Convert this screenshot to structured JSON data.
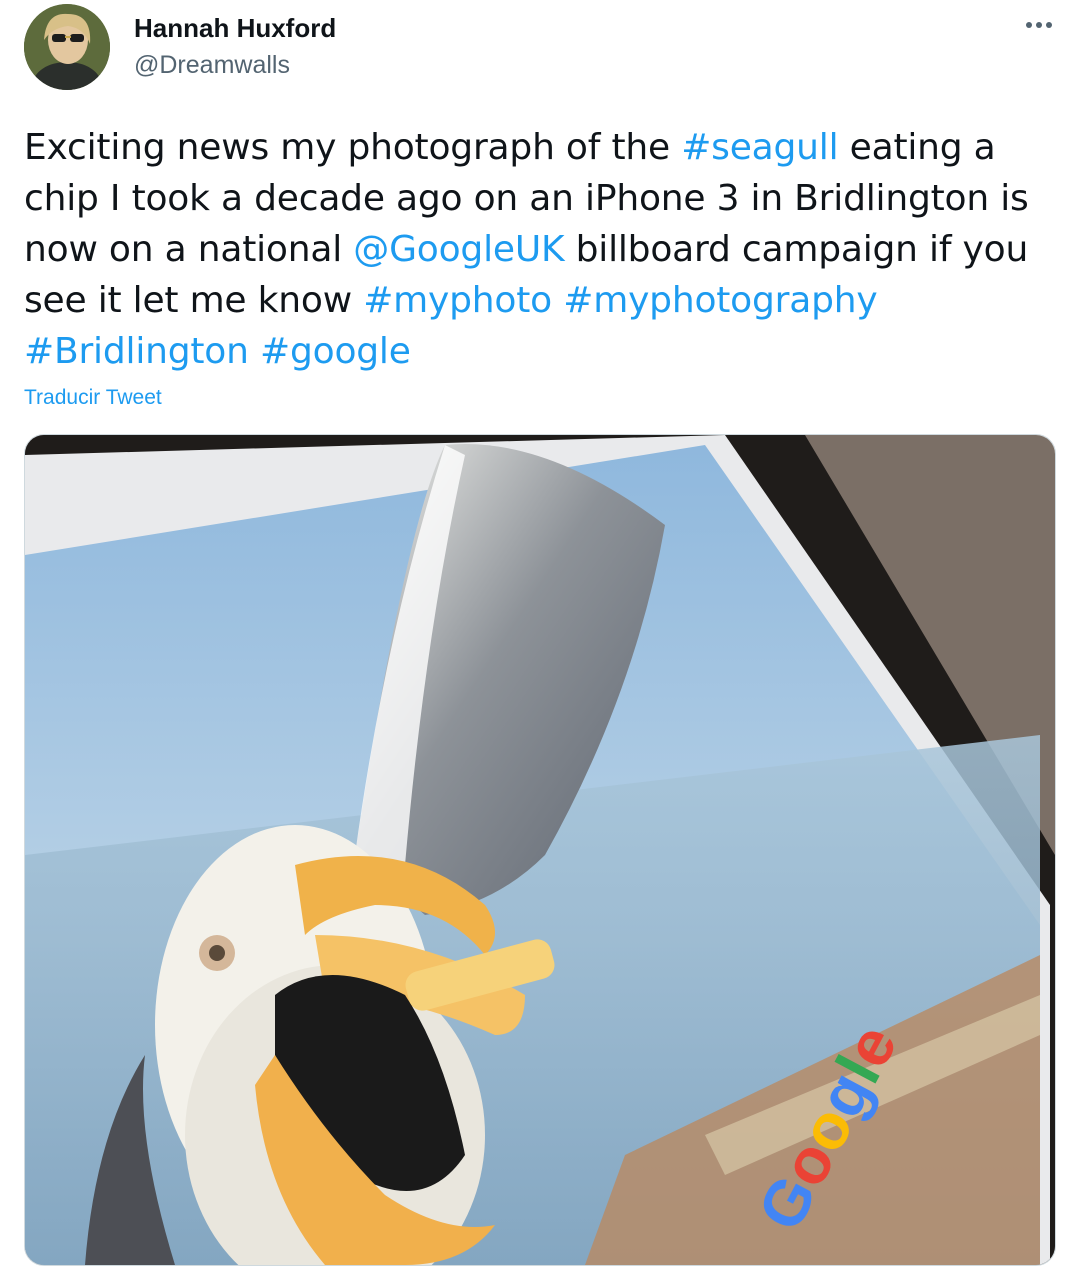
{
  "author": {
    "name": "Hannah Huxford",
    "handle": "@Dreamwalls",
    "avatar_icon": "user-avatar"
  },
  "more_icon": "more-horizontal-icon",
  "tweet": {
    "segments": [
      {
        "text": "Exciting news my photograph of the ",
        "link": false
      },
      {
        "text": "#seagull",
        "link": true
      },
      {
        "text": " eating a chip I took a decade ago on an iPhone 3 in Bridlington is now on a national ",
        "link": false
      },
      {
        "text": "@GoogleUK",
        "link": true
      },
      {
        "text": " billboard campaign if you see it let me know ",
        "link": false
      },
      {
        "text": "#myphoto",
        "link": true
      },
      {
        "text": " ",
        "link": false
      },
      {
        "text": "#myphotography",
        "link": true
      },
      {
        "text": " ",
        "link": false
      },
      {
        "text": "#Bridlington",
        "link": true
      },
      {
        "text": " ",
        "link": false
      },
      {
        "text": "#google",
        "link": true
      }
    ],
    "translate_label": "Traducir Tweet"
  },
  "media": {
    "billboard_logo": "Google"
  },
  "colors": {
    "link": "#1d9bf0",
    "text": "#0f1419",
    "secondary": "#536471"
  }
}
